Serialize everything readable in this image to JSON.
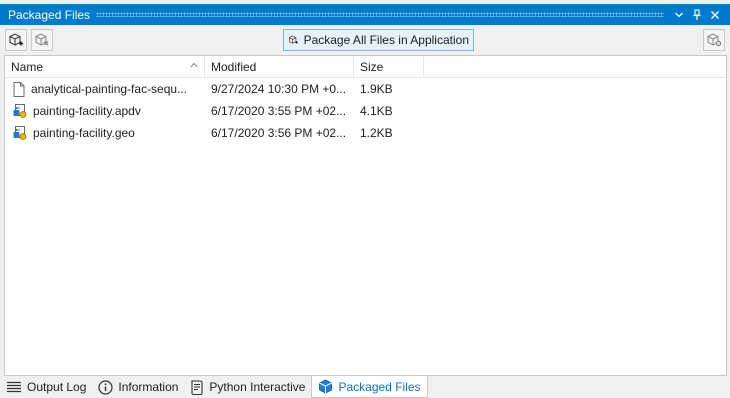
{
  "window": {
    "title": "Packaged Files",
    "accent_color": "#007acc"
  },
  "title_buttons": {
    "dropdown_icon": "chevron-down-icon",
    "pin_icon": "pin-icon",
    "close_icon": "close-icon"
  },
  "toolbar": {
    "add_icon": "package-add-icon",
    "remove_icon": "package-remove-icon",
    "package_all_label": "Package All Files in Application",
    "package_all_icon": "package-add-icon",
    "settings_icon": "package-settings-icon"
  },
  "columns": {
    "name": "Name",
    "modified": "Modified",
    "size": "Size"
  },
  "files": [
    {
      "name": "analytical-painting-fac-sequ...",
      "modified": "9/27/2024 10:30 PM +0...",
      "size": "1.9KB",
      "icon": "document-icon"
    },
    {
      "name": "painting-facility.apdv",
      "modified": "6/17/2020 3:55 PM +02...",
      "size": "4.1KB",
      "icon": "model-file-icon"
    },
    {
      "name": "painting-facility.geo",
      "modified": "6/17/2020 3:56 PM +02...",
      "size": "1.2KB",
      "icon": "model-file-icon"
    }
  ],
  "tabs": [
    {
      "label": "Output Log",
      "icon": "output-log-icon",
      "active": false
    },
    {
      "label": "Information",
      "icon": "info-icon",
      "active": false
    },
    {
      "label": "Python Interactive",
      "icon": "python-script-icon",
      "active": false
    },
    {
      "label": "Packaged Files",
      "icon": "package-icon",
      "active": true
    }
  ]
}
